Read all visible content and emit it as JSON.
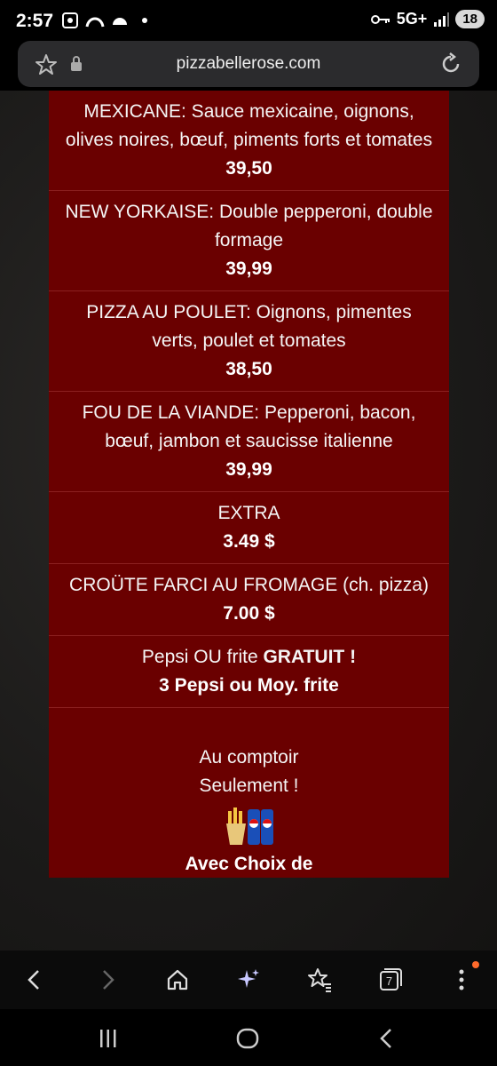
{
  "status_bar": {
    "time": "2:57",
    "network": "5G+",
    "battery": "18"
  },
  "address_bar": {
    "url": "pizzabellerose.com"
  },
  "menu": {
    "items": [
      {
        "desc": "MEXICANE: Sauce mexicaine, oignons, olives noires, bœuf, piments forts et tomates",
        "price": "39,50"
      },
      {
        "desc": "NEW YORKAISE: Double pepperoni, double formage",
        "price": "39,99"
      },
      {
        "desc": "PIZZA AU POULET: Oignons, pimentes verts, poulet et tomates",
        "price": "38,50"
      },
      {
        "desc": "FOU DE LA VIANDE: Pepperoni, bacon, bœuf, jambon et saucisse italienne",
        "price": "39,99"
      },
      {
        "desc": "EXTRA",
        "price": "3.49 $"
      },
      {
        "desc": "CROÜTE FARCI AU FROMAGE (ch. pizza)",
        "price": "7.00 $"
      }
    ],
    "promo": {
      "text": "Pepsi OU frite ",
      "text_bold": "GRATUIT !",
      "subtitle": "3 Pepsi ou Moy. frite"
    },
    "counter": {
      "line1": "Au comptoir",
      "line2": "Seulement !",
      "choice": "Avec Choix de"
    }
  },
  "toolbar": {
    "tabs_count": "7"
  },
  "colors": {
    "menu_bg": "#6a0000",
    "divider": "#8b2020",
    "notification_dot": "#ff6a2b"
  },
  "icons": [
    "star-icon",
    "lock-icon",
    "reload-icon",
    "back-icon",
    "forward-icon",
    "home-icon",
    "sparkle-icon",
    "bookmarks-icon",
    "tabs-icon",
    "more-icon",
    "recent-apps-icon",
    "home-pill-icon",
    "system-back-icon"
  ]
}
